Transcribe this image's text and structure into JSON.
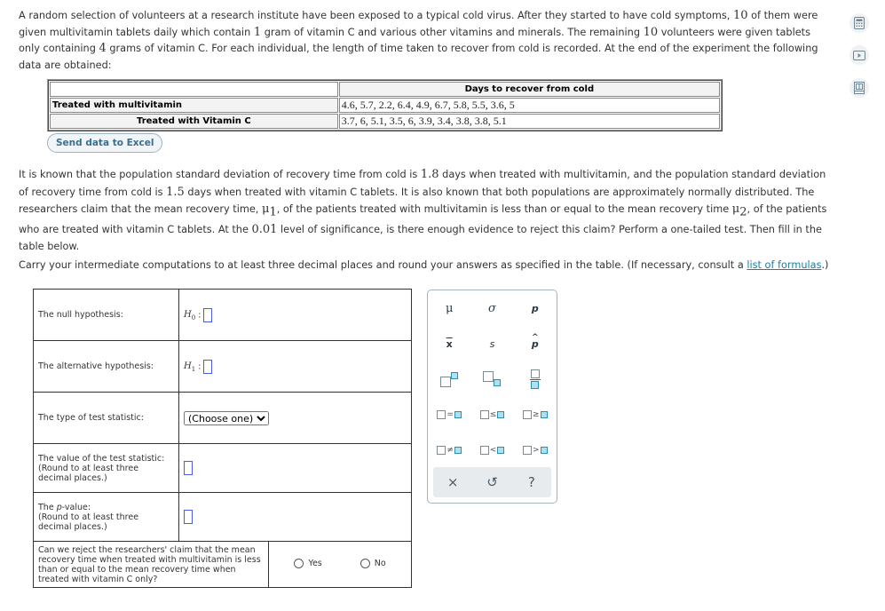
{
  "intro": {
    "a": "A random selection of volunteers at a research institute have been exposed to a typical cold virus. After they started to have cold symptoms, ",
    "n1": "10",
    "b": " of them were given multivitamin tablets daily which contain ",
    "g1": "1",
    "c": " gram of vitamin C and various other vitamins and minerals. The remaining ",
    "n2": "10",
    "d": " volunteers were given tablets only containing ",
    "g2": "4",
    "e": " grams of vitamin C. For each individual, the length of time taken to recover from cold is recorded. At the end of the experiment the following data are obtained:"
  },
  "data_table": {
    "header": "Days to recover from cold",
    "rows": [
      {
        "label": "Treated with multivitamin",
        "values": "4.6, 5.7, 2.2, 6.4, 4.9, 6.7, 5.8, 5.5, 3.6, 5"
      },
      {
        "label": "Treated with Vitamin C",
        "values": "3.7, 6, 5.1, 3.5, 6, 3.9, 3.4, 3.8, 3.8, 5.1"
      }
    ]
  },
  "excel_button": "Send data to Excel",
  "question": {
    "a": "It is known that the population standard deviation of recovery time from cold is ",
    "sd1": "1.8",
    "b": " days when treated with multivitamin, and the population standard deviation of recovery time from cold is ",
    "sd2": "1.5",
    "c": " days when treated with vitamin C tablets. It is also known that both populations are approximately normally distributed. The researchers claim that the mean recovery time, ",
    "mu1": "μ",
    "mu1_sub": "1",
    "d": ", of the patients treated with multivitamin is less than or equal to the mean recovery time ",
    "mu2": "μ",
    "mu2_sub": "2",
    "e": ", of the patients who are treated with vitamin C tablets. At the ",
    "alpha": "0.01",
    "f": " level of significance, is there enough evidence to reject this claim? Perform a one-tailed test. Then fill in the table below."
  },
  "instructions": {
    "text": "Carry your intermediate computations to at least three decimal places and round your answers as specified in the table. (If necessary, consult a ",
    "link": "list of formulas",
    "end": ".)"
  },
  "answer_table": {
    "null_label": "The null hypothesis:",
    "null_sym": "H",
    "null_sub": "0",
    "alt_label": "The alternative hypothesis:",
    "alt_sym": "H",
    "alt_sub": "1",
    "colon": ":",
    "type_label": "The type of test statistic:",
    "type_select": "(Choose one)",
    "value_label": "The value of the test statistic:",
    "value_note": "(Round to at least three decimal places.)",
    "p_label_pre": "The ",
    "p_label_p": "p",
    "p_label_post": "-value:",
    "p_note": "(Round to at least three decimal places.)",
    "reject_q": "Can we reject the researchers' claim that the mean recovery time when treated with multivitamin is less than or equal to the mean recovery time when treated with vitamin C only?",
    "yes": "Yes",
    "no": "No"
  },
  "palette": {
    "mu": "μ",
    "sigma": "σ",
    "p": "p",
    "xbar": "x",
    "s": "s",
    "phat": "p",
    "eq": "=",
    "le": "≤",
    "ge": "≥",
    "ne": "≠",
    "lt": "<",
    "gt": ">",
    "clear": "×",
    "undo": "↺",
    "help": "?"
  }
}
